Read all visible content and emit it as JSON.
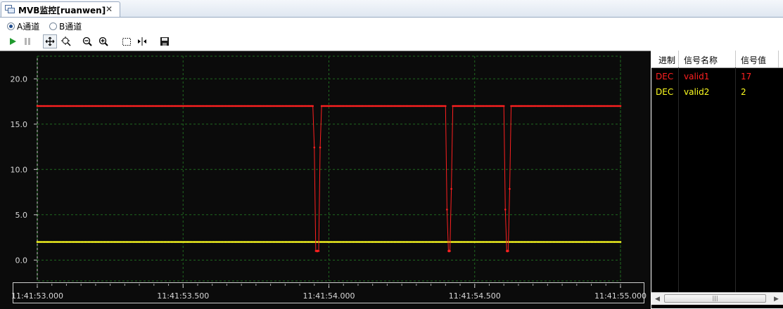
{
  "tab": {
    "title": "MVB监控[ruanwen]",
    "close": "✕"
  },
  "channels": [
    {
      "label": "A通道",
      "selected": true
    },
    {
      "label": "B通道",
      "selected": false
    }
  ],
  "toolbar": {
    "items": [
      "play-icon",
      "pause-icon",
      "pan-icon",
      "zoom-fit-icon",
      "zoom-out-icon",
      "zoom-in-icon",
      "select-region-icon",
      "marker-icon",
      "save-icon"
    ]
  },
  "legend": {
    "headers": [
      "进制",
      "信号名称",
      "信号值"
    ],
    "rows": [
      {
        "base": "DEC",
        "name": "valid1",
        "value": "17",
        "color": "#ff2020"
      },
      {
        "base": "DEC",
        "name": "valid2",
        "value": "2",
        "color": "#ffff20"
      }
    ]
  },
  "chart_data": {
    "type": "line",
    "ylim": [
      -2.3,
      22.5
    ],
    "yticks": [
      "0.0",
      "5.0",
      "10.0",
      "15.0",
      "20.0"
    ],
    "yvalues": [
      0,
      5,
      10,
      15,
      20
    ],
    "xticks": [
      "11:41:53.000",
      "11:41:53.500",
      "11:41:54.000",
      "11:41:54.500",
      "11:41:55.000"
    ],
    "grid": true,
    "series": [
      {
        "name": "valid1",
        "color": "#ff2020",
        "baseline": 17,
        "dips": [
          {
            "at": 0.48,
            "min": 1
          },
          {
            "at": 0.706,
            "min": 1
          },
          {
            "at": 0.806,
            "min": 1
          }
        ]
      },
      {
        "name": "valid2",
        "color": "#ffff20",
        "baseline": 2,
        "dips": []
      }
    ]
  }
}
